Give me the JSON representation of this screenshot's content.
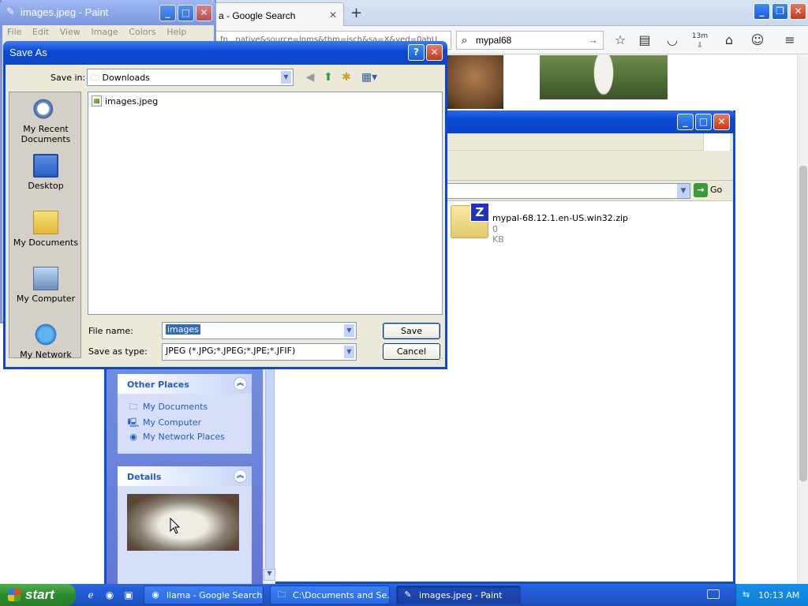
{
  "browser": {
    "tab_title": "a - Google Search",
    "url_fragment": "fp...native&source=lnms&tbm=isch&sa=X&ved=0ahU",
    "search_value": "mypal68",
    "downloads_badge": "13m"
  },
  "paint": {
    "title": "images.jpeg - Paint",
    "menu": [
      "File",
      "Edit",
      "View",
      "Image",
      "Colors",
      "Help"
    ]
  },
  "explorer": {
    "go_label": "Go",
    "file_name": "mypal-68.12.1.en-US.win32.zip",
    "file_size": "0 KB",
    "other_places": {
      "title": "Other Places",
      "items": [
        "My Documents",
        "My Computer",
        "My Network Places"
      ]
    },
    "details": {
      "title": "Details"
    }
  },
  "dialog": {
    "title": "Save As",
    "save_in_label": "Save in:",
    "save_in_value": "Downloads",
    "places": [
      "My Recent Documents",
      "Desktop",
      "My Documents",
      "My Computer",
      "My Network"
    ],
    "files": [
      "images.jpeg"
    ],
    "file_name_label": "File name:",
    "file_name_value": "images",
    "save_type_label": "Save as type:",
    "save_type_value": "JPEG (*.JPG;*.JPEG;*.JPE;*.JFIF)",
    "save_button": "Save",
    "cancel_button": "Cancel"
  },
  "taskbar": {
    "start_label": "start",
    "tasks": [
      "llama - Google Search...",
      "C:\\Documents and Se...",
      "images.jpeg - Paint"
    ],
    "clock": "10:13 AM"
  },
  "colors": {
    "xp_blue": "#0a48d2",
    "start_green": "#2e8b2e",
    "tray_blue": "#0f7fd6"
  }
}
